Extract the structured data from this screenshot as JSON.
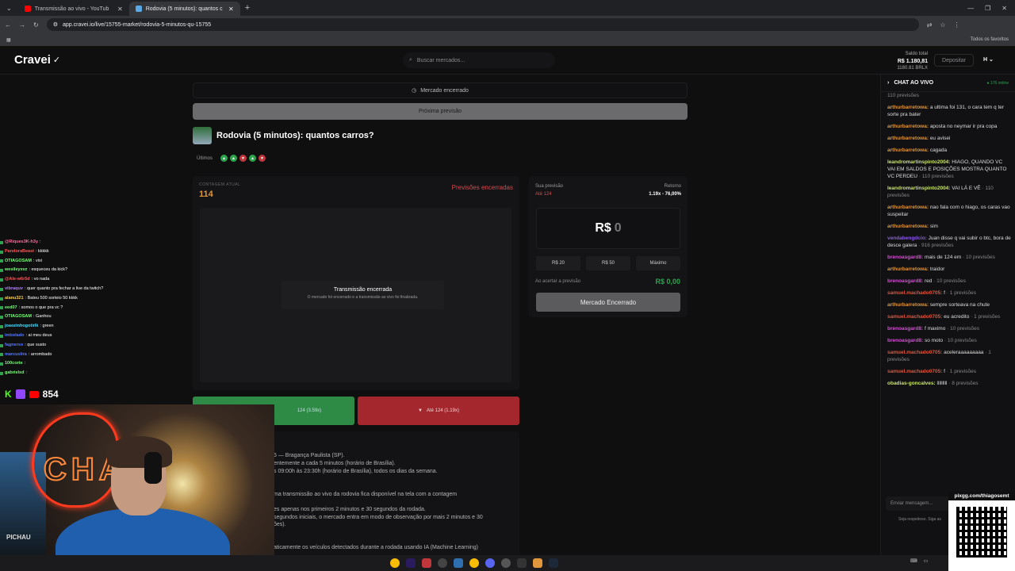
{
  "browser": {
    "tabs": [
      {
        "label": "Transmissão ao vivo - YouTub",
        "color": "#ff0000"
      },
      {
        "label": "Rodovia (5 minutos): quantos c",
        "color": "#5aa9e6"
      }
    ],
    "url": "app.cravei.io/live/15755-market/rodovia-5-minutos-qu-15755",
    "bookmarks_right": "Todos os favoritos"
  },
  "header": {
    "logo": "Cravei",
    "search_placeholder": "Buscar mercados...",
    "balance_label": "Saldo total",
    "balance_amount": "R$ 1.180,81",
    "balance_sub": "1180.81 BRLX",
    "deposit_label": "Depositar",
    "user_initial": "H"
  },
  "market": {
    "closed_banner": "Mercado encerrado",
    "next_button": "Próxima previsão",
    "title": "Rodovia (5 minutos): quantos carros?",
    "ultimos_label": "Últimos",
    "ultimos": [
      "up",
      "up",
      "down",
      "up",
      "down"
    ],
    "count_label": "CONTAGEM ATUAL",
    "count_value": "114",
    "predictions_closed": "Previsões encerradas",
    "stream_ended_title": "Transmissão encerrada",
    "stream_ended_sub": "O mercado foi encerrado e a transmissão ao vivo foi finalizada.",
    "btn_over": "124 (3.59x)",
    "btn_under": "Até 124 (1.19x)",
    "info_lines": [
      "5 — Bragança Paulista (SP).",
      "entemente a cada 5 minutos (horário de Brasília).",
      "s 09:00h às 23:30h (horário de Brasília), todos os dias da semana.",
      "ma transmissão ao vivo da rodovia fica disponível na tela com a contagem",
      "es apenas nos primeiros 2 minutos e 30 segundos da rodada.",
      "segundos iniciais, o mercado entra em modo de observação por mais 2 minutos e 30",
      "ões).",
      "aticamente os veículos detectados durante a rodada usando IA (Machine Learning)"
    ]
  },
  "bet": {
    "your_label": "Sua previsão",
    "your_value": "Até 124",
    "return_label": "Retorno",
    "return_value": "1.19x - 76,00%",
    "amount_prefix": "R$",
    "amount_value": "0",
    "quick": [
      "R$ 20",
      "R$ 50",
      "Máximo"
    ],
    "win_label": "Ao acertar a previsão",
    "win_value": "R$ 0,00",
    "closed_btn": "Mercado Encerrado"
  },
  "chat": {
    "title": "CHAT AO VIVO",
    "online": "176 online",
    "messages": [
      {
        "user": "",
        "text": "",
        "suffix": "110 previsões",
        "color": "#888"
      },
      {
        "user": "arthurbarretowa:",
        "text": " a ultima foi 131, o cara tem q ter sorte pra bater",
        "suffix": "",
        "color": "#e0963b"
      },
      {
        "user": "arthurbarretowa:",
        "text": " aposta no neymar ir pra copa",
        "suffix": "",
        "color": "#e0963b"
      },
      {
        "user": "arthurbarretowa:",
        "text": " eu avisei",
        "suffix": "",
        "color": "#e0963b"
      },
      {
        "user": "arthurbarretowa:",
        "text": " cagada",
        "suffix": "",
        "color": "#e0963b"
      },
      {
        "user": "leandromartinspinto2004:",
        "text": " HIAGO, QUANDO VC VAI EM SALDOS E POSIÇÕES MOSTRA QUANTO VC PERDEU",
        "suffix": " · 110 previsões",
        "color": "#c9e36b"
      },
      {
        "user": "leandromartinspinto2004:",
        "text": " VAI LÁ E VÊ",
        "suffix": " · 110 previsões",
        "color": "#c9e36b"
      },
      {
        "user": "arthurbarretowa:",
        "text": " nao fala com o hiago, os caras vao suspeitar",
        "suffix": "",
        "color": "#e0963b"
      },
      {
        "user": "arthurbarretowa:",
        "text": " sim",
        "suffix": "",
        "color": "#e0963b"
      },
      {
        "user": "vendabengdcio:",
        "text": " Juan disse q vai subir o btc, bora de desce galera",
        "suffix": " · 916 previsões",
        "color": "#8a5be0"
      },
      {
        "user": "brenoasgard8:",
        "text": " mais de 124 em",
        "suffix": " · 10 previsões",
        "color": "#d84dd8"
      },
      {
        "user": "arthurbarretowa:",
        "text": " traidor",
        "suffix": "",
        "color": "#e0963b"
      },
      {
        "user": "brenoasgard8:",
        "text": " red",
        "suffix": " · 10 previsões",
        "color": "#d84dd8"
      },
      {
        "user": "samuel.machado0705:",
        "text": " f",
        "suffix": " · 1 previsões",
        "color": "#e0553b"
      },
      {
        "user": "arthurbarretowa:",
        "text": " sempre sorteava na chute",
        "suffix": "",
        "color": "#e0963b"
      },
      {
        "user": "samuel.machado0705:",
        "text": " eu acredito",
        "suffix": " · 1 previsões",
        "color": "#e0553b"
      },
      {
        "user": "brenoasgard8:",
        "text": " f maximo",
        "suffix": " · 10 previsões",
        "color": "#d84dd8"
      },
      {
        "user": "brenoasgard8:",
        "text": " so moto",
        "suffix": " · 10 previsões",
        "color": "#d84dd8"
      },
      {
        "user": "samuel.machado0705:",
        "text": " aceleraaaaaaaaa",
        "suffix": " · 1 previsões",
        "color": "#e0553b"
      },
      {
        "user": "samuel.machado0705:",
        "text": " f",
        "suffix": " · 1 previsões",
        "color": "#e0553b"
      },
      {
        "user": "obadias-goncalves:",
        "text": " lllllllll",
        "suffix": " · 8 previsões",
        "color": "#c9e36b"
      }
    ],
    "input_placeholder": "Enviar mensagem...",
    "note": "Seja respeitoso. Siga as"
  },
  "overlay": {
    "chat": [
      {
        "user": "@Riques3K-h3y",
        "text": " :",
        "color": "#ff6b9a"
      },
      {
        "user": "PandoraBeast",
        "text": " : kkkkk",
        "color": "#ff5555"
      },
      {
        "user": "OTIAGOSAM",
        "text": " : vixi",
        "color": "#7cfc7c"
      },
      {
        "user": "wesileyxvz",
        "text": " : esqueceu da kick?",
        "color": "#7cfc7c"
      },
      {
        "user": "@Ale-w6r5d",
        "text": " : vo nada",
        "color": "#ff5555"
      },
      {
        "user": "vibraquv",
        "text": " : quer quanto pra fechar a live da twitch?",
        "color": "#b47cff"
      },
      {
        "user": "alanu321",
        "text": " : Bateu 500 sorteio 50 kkkk",
        "color": "#ffcc44"
      },
      {
        "user": "eed07",
        "text": " : somos o que pra vc ?",
        "color": "#7cfc7c"
      },
      {
        "user": "OTIAGOSAM",
        "text": " : Ganhou",
        "color": "#7cfc7c"
      },
      {
        "user": "joaozinhogotirlk",
        "text": " : green",
        "color": "#44ddff"
      },
      {
        "user": "imbolado",
        "text": " : ai meu deus",
        "color": "#5577ff"
      },
      {
        "user": "fagnerso",
        "text": " : que susto",
        "color": "#5577ff"
      },
      {
        "user": "marcuslira",
        "text": " : arrombado",
        "color": "#5577ff"
      },
      {
        "user": "100corte",
        "text": " :",
        "color": "#7cfc7c"
      },
      {
        "user": "gabrielxd",
        "text": " :",
        "color": "#7cfc7c"
      }
    ],
    "viewers": "854",
    "poster_logo": "PICHAU",
    "pix_label": "pixgg.com/thiagosemt"
  }
}
